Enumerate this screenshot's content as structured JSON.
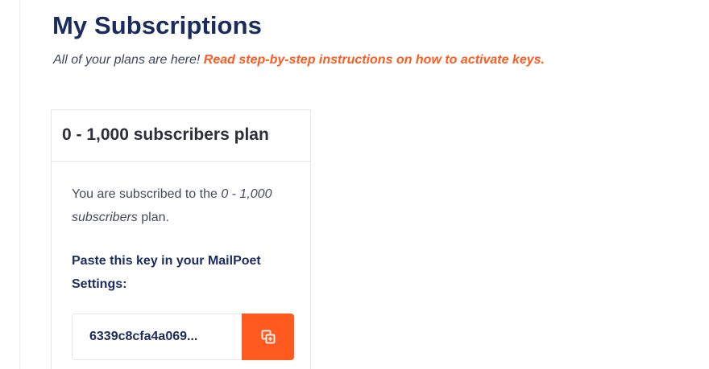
{
  "header": {
    "title": "My Subscriptions",
    "subtitle_text": "All of your plans are here! ",
    "subtitle_link": "Read step-by-step instructions on how to activate keys."
  },
  "card": {
    "title": "0 - 1,000 subscribers plan",
    "desc_prefix": "You are subscribed to the ",
    "desc_plan": "0 - 1,000 subscribers",
    "desc_suffix": " plan.",
    "key_label": "Paste this key in your MailPoet Settings:",
    "key_value": "6339c8cfa4a069...",
    "copy_icon": "copy-icon"
  },
  "colors": {
    "heading": "#1a2b5e",
    "accent": "#ff5a1f",
    "border": "#e3e5ea"
  }
}
